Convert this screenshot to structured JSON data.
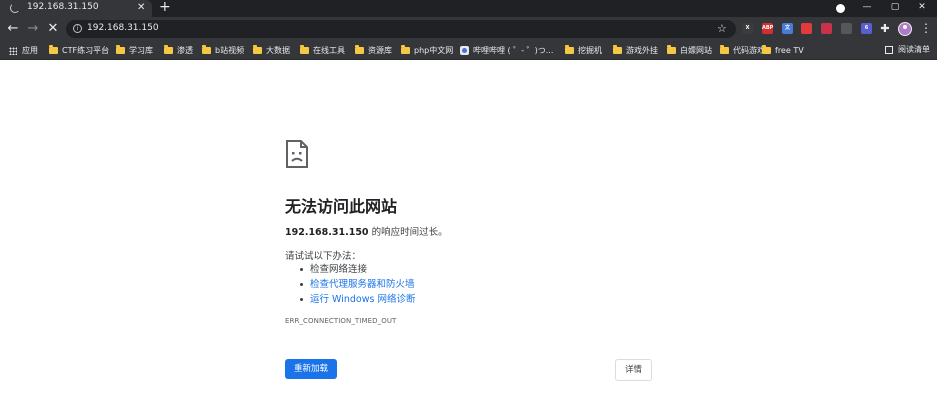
{
  "tab": {
    "title": "192.168.31.150",
    "close": "✕",
    "new_tab": "+"
  },
  "window_controls": {
    "minimize": "—",
    "maximize": "▢",
    "close": "✕"
  },
  "toolbar": {
    "back": "←",
    "forward": "→",
    "stop": "✕",
    "url": "192.168.31.150",
    "star": "☆"
  },
  "extensions": [
    {
      "name": "x-extension-icon",
      "label": "X",
      "color": "#3c3c3c"
    },
    {
      "name": "abp-extension-icon",
      "label": "ABP",
      "color": "#d62e2e"
    },
    {
      "name": "translate-extension-icon",
      "label": "文",
      "color": "#4a7bd9"
    },
    {
      "name": "red-extension-icon",
      "label": "",
      "color": "#e23b3b"
    },
    {
      "name": "pink-extension-icon",
      "label": "",
      "color": "#c8324b"
    },
    {
      "name": "gray-extension-icon",
      "label": "",
      "color": "#55575b"
    },
    {
      "name": "badge-extension-icon",
      "label": "6",
      "color": "#5a5fd0"
    }
  ],
  "bookmarks": [
    {
      "label": "应用",
      "type": "apps"
    },
    {
      "label": "CTF练习平台",
      "type": "folder"
    },
    {
      "label": "学习库",
      "type": "folder"
    },
    {
      "label": "渗透",
      "type": "folder"
    },
    {
      "label": "b站视频",
      "type": "folder"
    },
    {
      "label": "大数据",
      "type": "folder"
    },
    {
      "label": "在线工具",
      "type": "folder"
    },
    {
      "label": "资源库",
      "type": "folder"
    },
    {
      "label": "php中文网",
      "type": "folder"
    },
    {
      "label": "哔哩哔哩 ( ゜- ゜)つ...",
      "type": "favicon"
    },
    {
      "label": "挖掘机",
      "type": "folder"
    },
    {
      "label": "游戏外挂",
      "type": "folder"
    },
    {
      "label": "白嫖网站",
      "type": "folder"
    },
    {
      "label": "代码游戏",
      "type": "folder"
    },
    {
      "label": "free TV",
      "type": "folder"
    }
  ],
  "reading_list": "阅读清单",
  "error": {
    "heading": "无法访问此网站",
    "host": "192.168.31.150",
    "desc_suffix": " 的响应时间过长。",
    "suggest_title": "请试试以下办法：",
    "suggestions": [
      "检查网络连接",
      "检查代理服务器和防火墙",
      "运行 Windows 网络诊断"
    ],
    "code": "ERR_CONNECTION_TIMED_OUT",
    "reload_label": "重新加载",
    "details_label": "详情"
  },
  "colors": {
    "chrome_dark": "#35363a",
    "link_blue": "#1a73e8"
  }
}
